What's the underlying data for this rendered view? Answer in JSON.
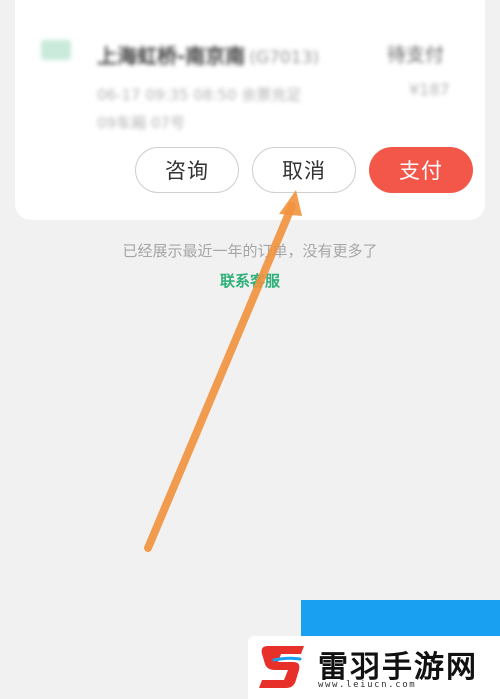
{
  "order": {
    "title": "上海虹桥-南京南",
    "title_suffix": "(G7013)",
    "status": "待支付",
    "detail": "06-17 09:35 08:50 余票充足",
    "price": "¥187",
    "seat": "09车厢 07号"
  },
  "actions": {
    "consult_label": "咨询",
    "cancel_label": "取消",
    "pay_label": "支付"
  },
  "footer": {
    "note": "已经展示最近一年的订单，没有更多了",
    "contact_label": "联系客服"
  },
  "annotation": {
    "arrow_color": "#f2923e"
  },
  "watermark": {
    "brand_name": "雷羽手游网",
    "url": "www.leiucn.com",
    "logo_color": "#e8302a",
    "accent_color": "#1aa0f0"
  },
  "colors": {
    "pay_button": "#f2574a",
    "contact_link": "#2fb07a",
    "background": "#f1f1f1"
  }
}
